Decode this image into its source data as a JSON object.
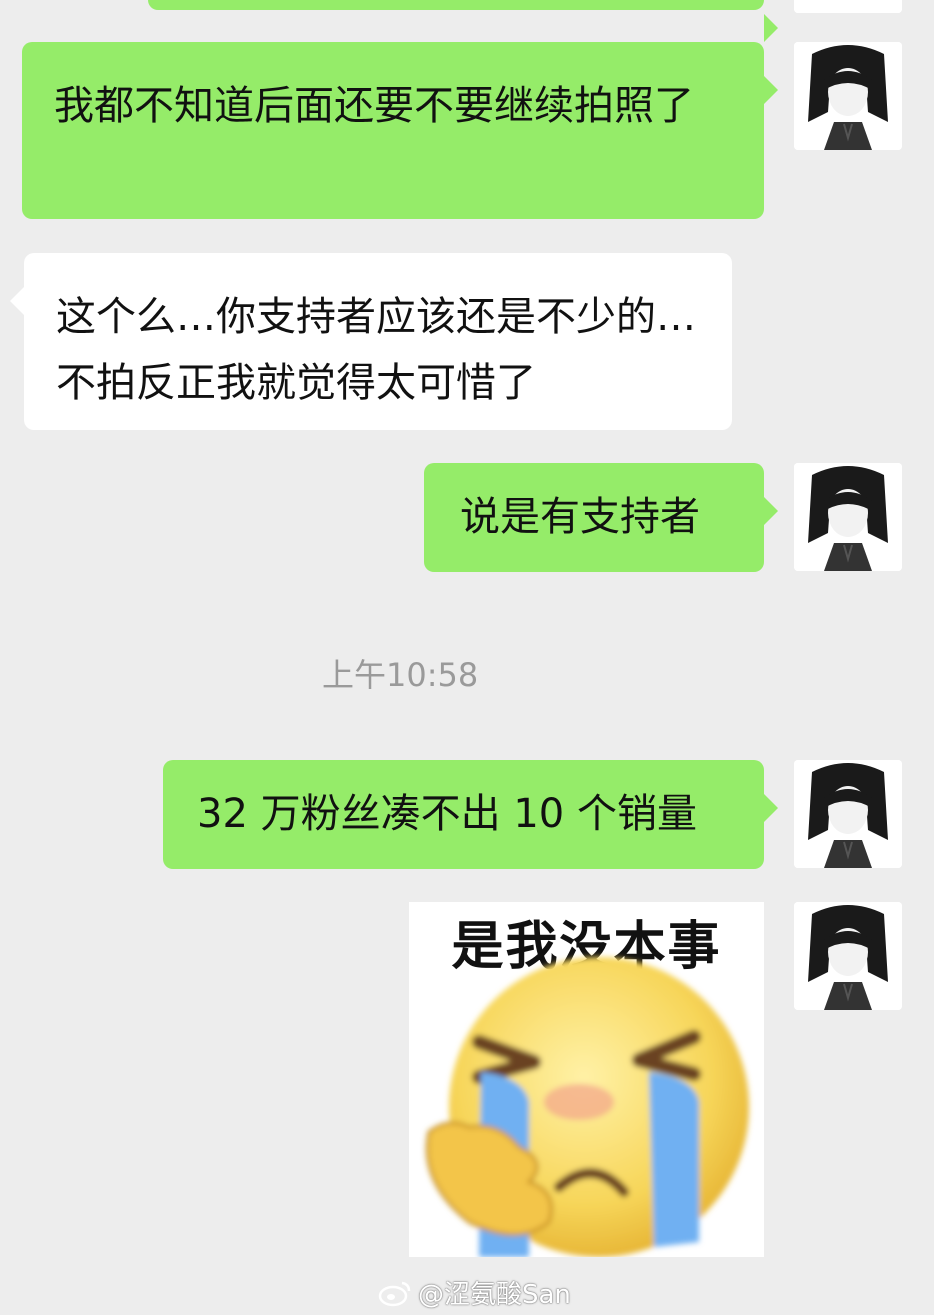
{
  "messages": [
    {
      "side": "me",
      "text": "我都不知道后面还要不要继续拍照了"
    },
    {
      "side": "them",
      "text": "这个么…你支持者应该还是不少的…不拍反正我就觉得太可惜了"
    },
    {
      "side": "me",
      "text": "说是有支持者"
    },
    {
      "side": "me",
      "text": "32 万粉丝凑不出 10 个销量"
    },
    {
      "side": "me",
      "type": "sticker",
      "caption": "是我没本事"
    }
  ],
  "timestamp": "上午10:58",
  "watermark": "@涩氨酸San",
  "colors": {
    "background": "#ededed",
    "my_bubble": "#95ec69",
    "their_bubble": "#ffffff",
    "timestamp_text": "#9a9a9a"
  },
  "icons": [
    "avatar",
    "crying-emoji-icon",
    "weibo-logo-icon"
  ]
}
